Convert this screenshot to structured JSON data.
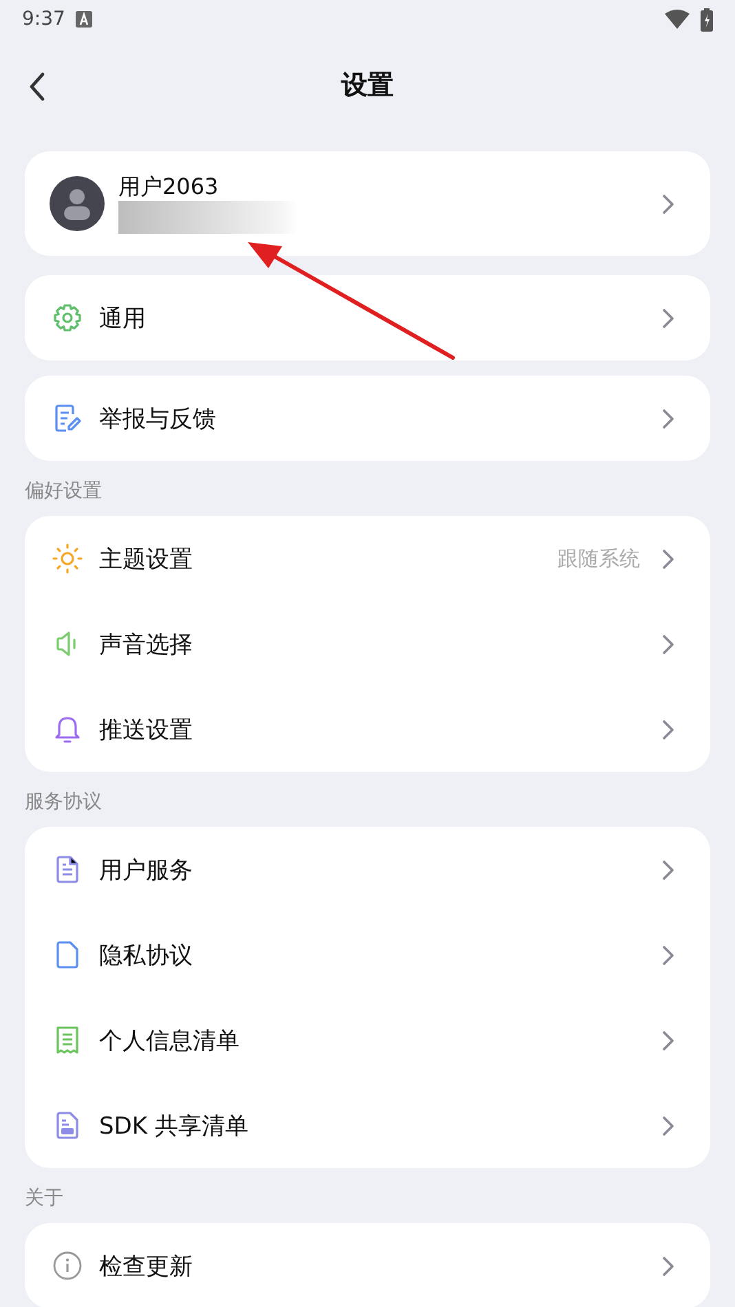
{
  "status_bar": {
    "time": "9:37"
  },
  "header": {
    "title": "设置"
  },
  "profile": {
    "name": "用户2063"
  },
  "groups": [
    {
      "rows": [
        {
          "label": "通用"
        }
      ]
    },
    {
      "rows": [
        {
          "label": "举报与反馈"
        }
      ]
    },
    {
      "section": "偏好设置",
      "rows": [
        {
          "label": "主题设置",
          "value": "跟随系统"
        },
        {
          "label": "声音选择"
        },
        {
          "label": "推送设置"
        }
      ]
    },
    {
      "section": "服务协议",
      "rows": [
        {
          "label": "用户服务"
        },
        {
          "label": "隐私协议"
        },
        {
          "label": "个人信息清单"
        },
        {
          "label": "SDK 共享清单"
        }
      ]
    },
    {
      "section": "关于",
      "rows": [
        {
          "label": "检查更新"
        }
      ]
    }
  ]
}
